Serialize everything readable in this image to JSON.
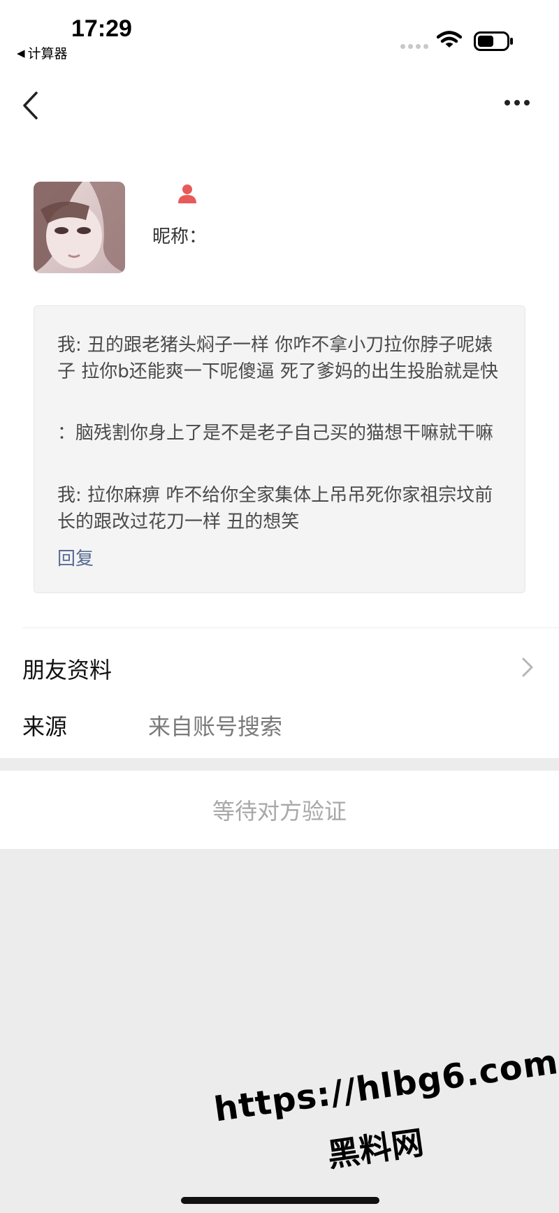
{
  "status_bar": {
    "time": "17:29",
    "back_app": "计算器",
    "back_app_arrow": "◀"
  },
  "nav": {
    "back_icon": "chevron-left-icon",
    "more_icon": "more-dots-icon"
  },
  "profile": {
    "gender_icon": "person-icon",
    "gender_color": "#e85a5a",
    "nickname_label": "昵称："
  },
  "messages": [
    {
      "text": "我: 丑的跟老猪头焖子一样 你咋不拿小刀拉你脖子呢婊子 拉你b还能爽一下呢傻逼 死了爹妈的出生投胎就是快"
    },
    {
      "text": "：脑残割你身上了是不是老子自己买的猫想干嘛就干嘛"
    },
    {
      "text": "我: 拉你麻痹 咋不给你全家集体上吊吊死你家祖宗坟前 长的跟改过花刀一样 丑的想笑"
    }
  ],
  "reply_label": "回复",
  "friend_info_label": "朋友资料",
  "source": {
    "label": "来源",
    "value": "来自账号搜索"
  },
  "waiting_label": "等待对方验证",
  "watermark": {
    "url": "https://hlbg6.com",
    "name": "黑料网"
  },
  "colors": {
    "link": "#576b95",
    "background": "#ececec"
  }
}
